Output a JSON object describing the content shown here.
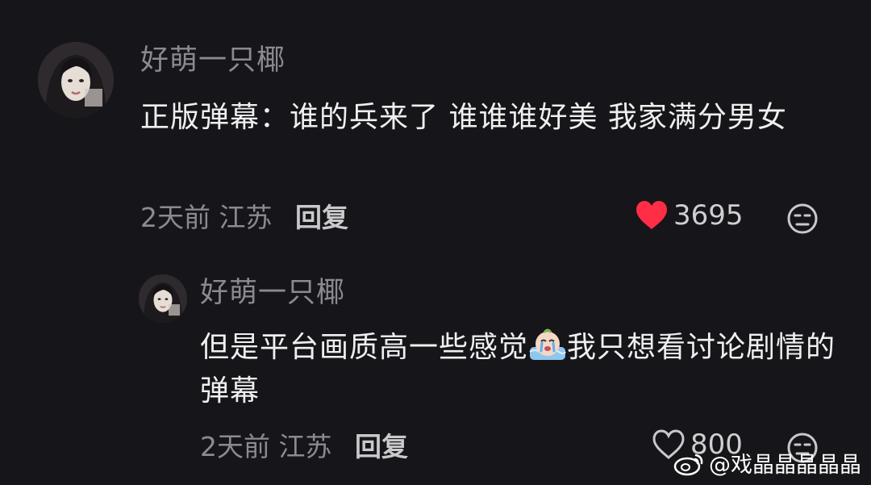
{
  "colors": {
    "background": "#161519",
    "username": "#8b8b8f",
    "content": "#efefef",
    "like_active": "#ff2d45"
  },
  "comments": [
    {
      "username": "好萌一只椰",
      "content": "正版弹幕：谁的兵来了 谁谁谁好美 我家满分男女",
      "time": "2天前",
      "location": "江苏",
      "reply_label": "回复",
      "likes": "3695",
      "liked": true,
      "avatar_icon": "user-avatar-photo"
    }
  ],
  "replies": [
    {
      "username": "好萌一只椰",
      "content_before": "但是平台画质高一些感觉",
      "emoji": "crying-baby-emoji",
      "content_after": "我只想看讨论剧情的弹幕",
      "time": "2天前",
      "location": "江苏",
      "reply_label": "回复",
      "likes": "800",
      "liked": false,
      "avatar_icon": "user-avatar-photo"
    }
  ],
  "watermark": {
    "text": "@戏晶晶晶晶晶",
    "icon": "weibo-logo-icon"
  }
}
